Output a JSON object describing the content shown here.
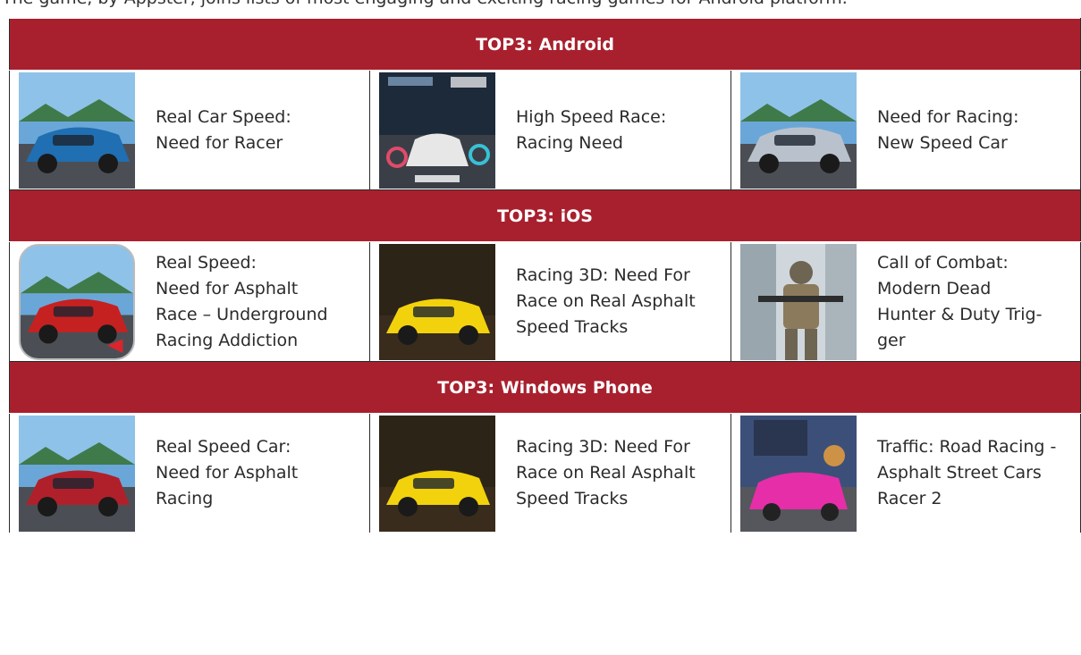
{
  "page": {
    "cut_text": "The game, by Appster, joins lists of most engaging and exciting racing games for Android platform."
  },
  "sections": [
    {
      "title": "TOP3: Android",
      "games": [
        {
          "name": "Real Car Speed:\nNeed for Racer",
          "icon": "blue-sports-car-icon",
          "color": "#1f6fb2"
        },
        {
          "name": "High Speed Race:\nRacing Need",
          "icon": "white-race-car-hud-icon",
          "color": "#e7e7e7"
        },
        {
          "name": "Need for Racing:\nNew Speed Car",
          "icon": "silver-sports-car-icon",
          "color": "#b9c2cc"
        }
      ]
    },
    {
      "title": "TOP3: iOS",
      "games": [
        {
          "name": "Real Speed:\nNeed for Asphalt\nRace – Underground\nRacing Addiction",
          "icon": "red-sports-car-icon",
          "color": "#c62121"
        },
        {
          "name": "Racing 3D: Need For\nRace on Real Asphalt\nSpeed Tracks",
          "icon": "yellow-supercar-icon",
          "color": "#f2d20d"
        },
        {
          "name": "Call of Combat:\nModern Dead\nHunter & Duty Trig-\nger",
          "icon": "soldier-icon",
          "color": "#8c7a5c"
        }
      ]
    },
    {
      "title": "TOP3: Windows Phone",
      "games": [
        {
          "name": "Real Speed Car:\nNeed for Asphalt\nRacing",
          "icon": "red-muscle-car-icon",
          "color": "#b0202a"
        },
        {
          "name": "Racing 3D: Need For\nRace on Real Asphalt\nSpeed Tracks",
          "icon": "yellow-supercar-icon",
          "color": "#f2d20d"
        },
        {
          "name": "Traffic: Road Racing -\nAsphalt Street Cars\nRacer 2",
          "icon": "pink-car-icon",
          "color": "#e62ea8"
        }
      ]
    }
  ]
}
